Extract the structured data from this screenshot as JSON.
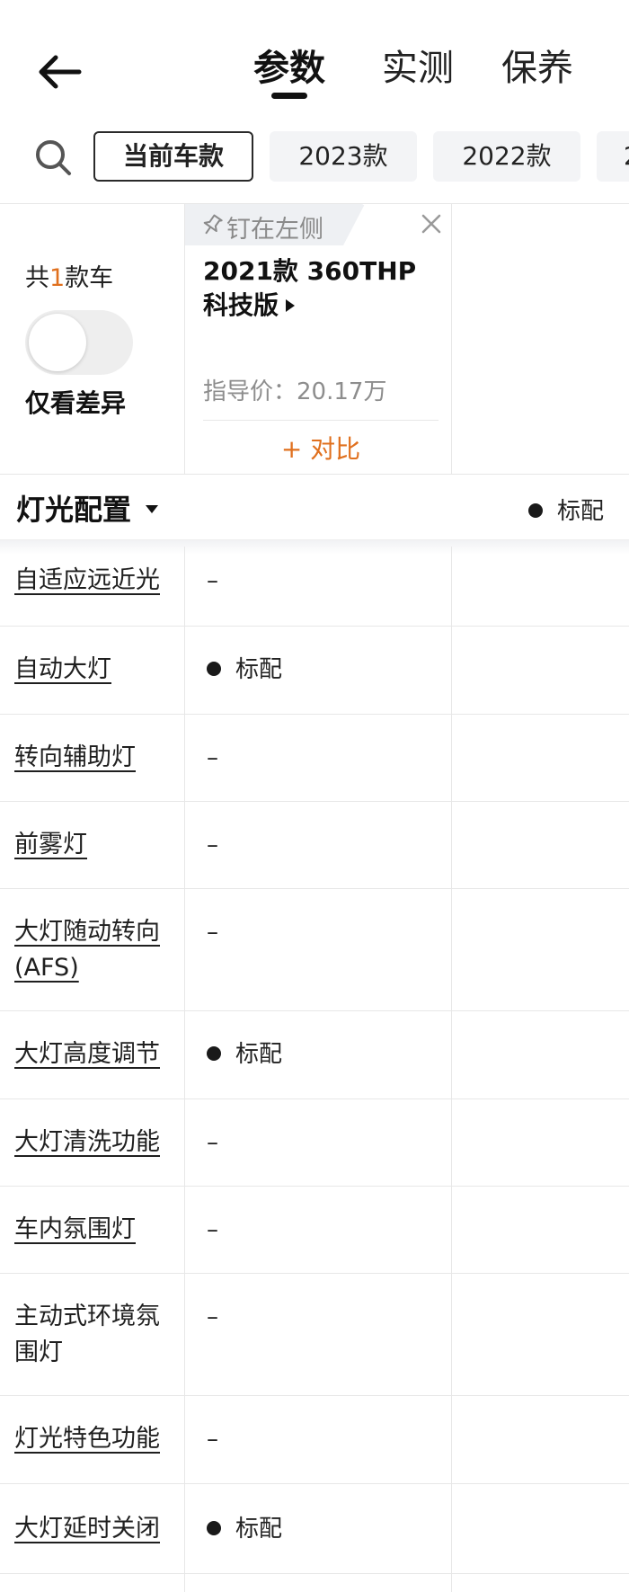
{
  "header": {
    "tabs": [
      {
        "label": "参数",
        "active": true
      },
      {
        "label": "实测",
        "active": false
      },
      {
        "label": "保养",
        "active": false
      }
    ]
  },
  "filters": {
    "chips": [
      {
        "label": "当前车款",
        "selected": true
      },
      {
        "label": "2023款",
        "selected": false
      },
      {
        "label": "2022款",
        "selected": false
      },
      {
        "label": "2",
        "selected": false
      }
    ]
  },
  "car": {
    "count_prefix": "共",
    "count": "1",
    "count_suffix": "款车",
    "diff_label": "仅看差异",
    "pin_label": "钉在左侧",
    "name": "2021款 360THP 科技版",
    "price_label": "指导价：",
    "price": "20.17万",
    "compare_label": "+ 对比"
  },
  "section": {
    "title": "灯光配置",
    "legend": "标配"
  },
  "rows": [
    {
      "name": "自适应远近光",
      "value": "–",
      "standard": false,
      "underline": true
    },
    {
      "name": "自动大灯",
      "value": "标配",
      "standard": true,
      "underline": true
    },
    {
      "name": "转向辅助灯",
      "value": "–",
      "standard": false,
      "underline": true
    },
    {
      "name": "前雾灯",
      "value": "–",
      "standard": false,
      "underline": true
    },
    {
      "name": "大灯随动转向(AFS)",
      "value": "–",
      "standard": false,
      "underline": true
    },
    {
      "name": "大灯高度调节",
      "value": "标配",
      "standard": true,
      "underline": true
    },
    {
      "name": "大灯清洗功能",
      "value": "–",
      "standard": false,
      "underline": true
    },
    {
      "name": "车内氛围灯",
      "value": "–",
      "standard": false,
      "underline": true
    },
    {
      "name": "主动式环境氛围灯",
      "value": "–",
      "standard": false,
      "underline": false
    },
    {
      "name": "灯光特色功能",
      "value": "–",
      "standard": false,
      "underline": true
    },
    {
      "name": "大灯延时关闭",
      "value": "标配",
      "standard": true,
      "underline": true
    }
  ],
  "colors": {
    "accent": "#e0701e",
    "text": "#1f1f1f",
    "muted": "#8d8d8d"
  }
}
